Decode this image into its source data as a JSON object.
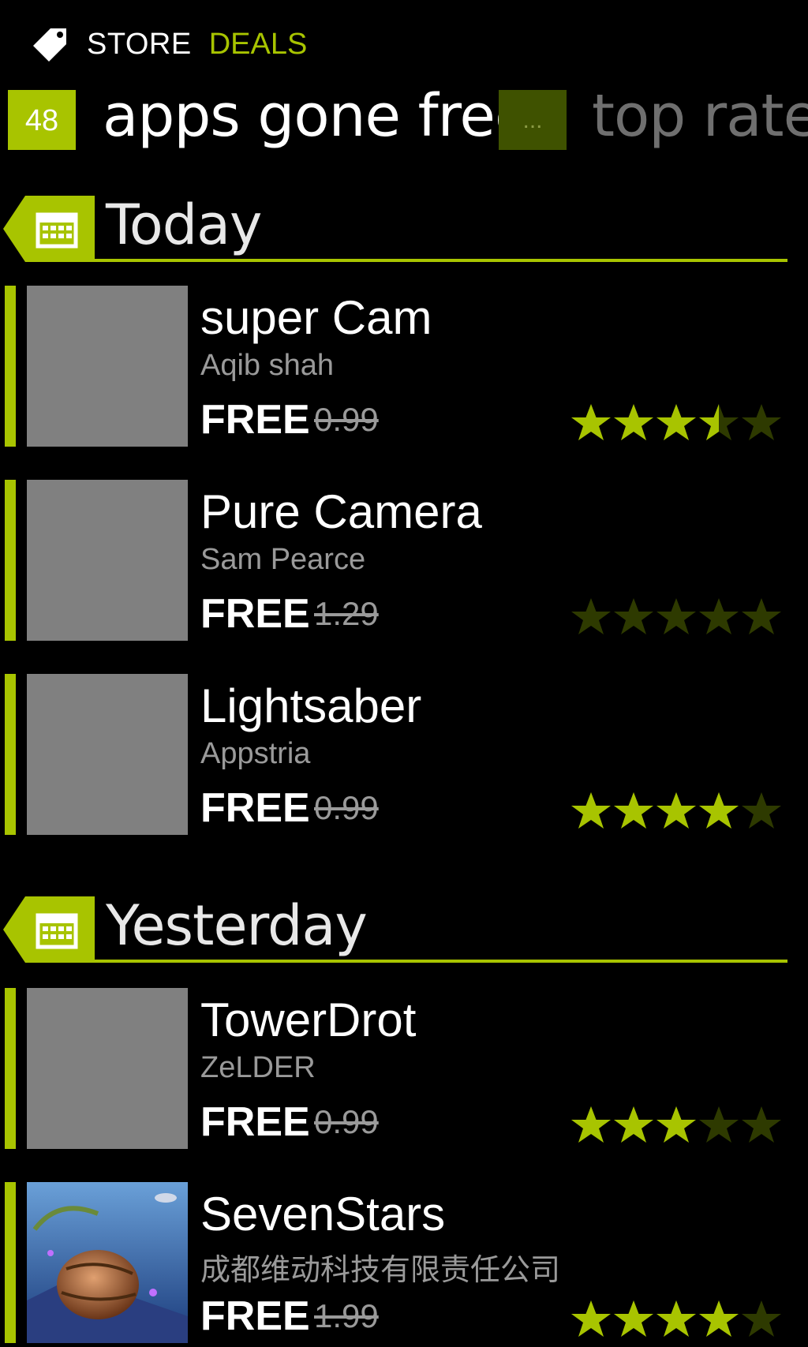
{
  "header": {
    "store_label": "STORE",
    "deals_label": "DEALS",
    "tag_icon": "tag-icon"
  },
  "pivot": {
    "count": "48",
    "title": "apps gone free",
    "next_badge": "...",
    "next_title": "top rated"
  },
  "colors": {
    "accent": "#a8c400",
    "dim_star": "#2e3a00",
    "thumb": "#808080"
  },
  "sections": [
    {
      "label": "Today",
      "items": [
        {
          "name": "super Cam",
          "developer": "Aqib shah",
          "price": "FREE",
          "old_price": "0.99",
          "rating": 3.5
        },
        {
          "name": "Pure Camera",
          "developer": "Sam Pearce",
          "price": "FREE",
          "old_price": "1.29",
          "rating": 0
        },
        {
          "name": "Lightsaber",
          "developer": "Appstria",
          "price": "FREE",
          "old_price": "0.99",
          "rating": 4
        }
      ]
    },
    {
      "label": "Yesterday",
      "items": [
        {
          "name": "TowerDrot",
          "developer": "ZeLDER",
          "price": "FREE",
          "old_price": "0.99",
          "rating": 3
        },
        {
          "name": "SevenStars",
          "developer": "成都维动科技有限责任公司",
          "price": "FREE",
          "old_price": "1.99",
          "rating": 4
        }
      ]
    }
  ]
}
